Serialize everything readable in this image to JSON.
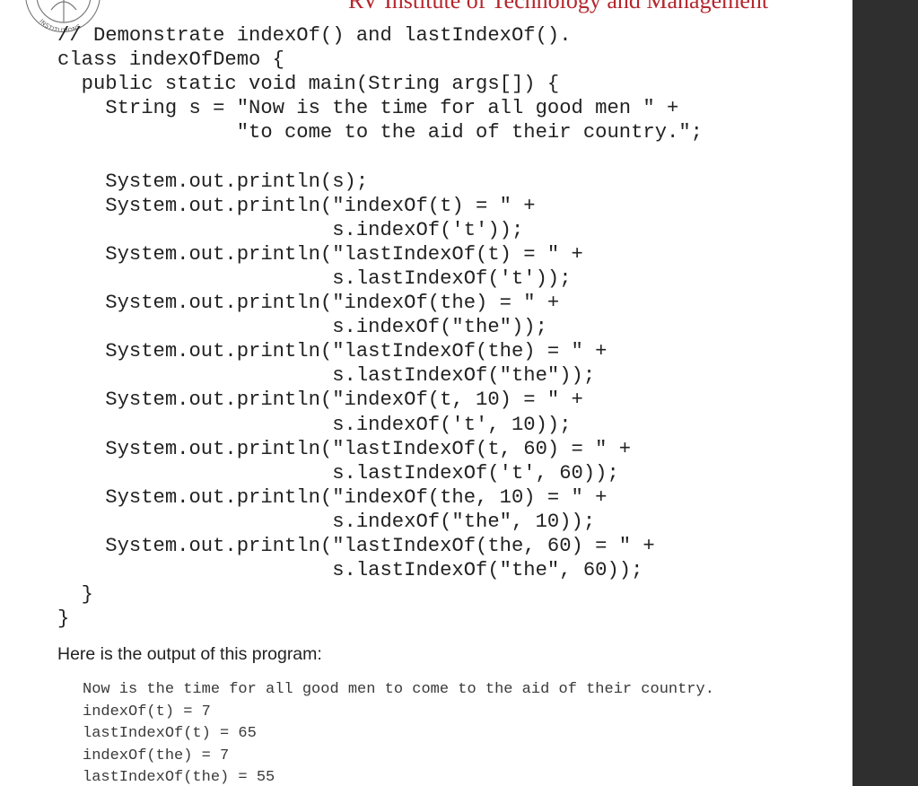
{
  "header": {
    "institute": "RV Institute of Technology and Management",
    "logo_text": "INSTITUTIONS"
  },
  "code_lines": [
    "// Demonstrate indexOf() and lastIndexOf().",
    "class indexOfDemo {",
    "  public static void main(String args[]) {",
    "    String s = \"Now is the time for all good men \" +",
    "               \"to come to the aid of their country.\";",
    "",
    "    System.out.println(s);",
    "    System.out.println(\"indexOf(t) = \" +",
    "                       s.indexOf('t'));",
    "    System.out.println(\"lastIndexOf(t) = \" +",
    "                       s.lastIndexOf('t'));",
    "    System.out.println(\"indexOf(the) = \" +",
    "                       s.indexOf(\"the\"));",
    "    System.out.println(\"lastIndexOf(the) = \" +",
    "                       s.lastIndexOf(\"the\"));",
    "    System.out.println(\"indexOf(t, 10) = \" +",
    "                       s.indexOf('t', 10));",
    "    System.out.println(\"lastIndexOf(t, 60) = \" +",
    "                       s.lastIndexOf('t', 60));",
    "    System.out.println(\"indexOf(the, 10) = \" +",
    "                       s.indexOf(\"the\", 10));",
    "    System.out.println(\"lastIndexOf(the, 60) = \" +",
    "                       s.lastIndexOf(\"the\", 60));",
    "  }",
    "}"
  ],
  "output_caption": "Here is the output of this program:",
  "output_lines": [
    "Now is the time for all good men to come to the aid of their country.",
    "indexOf(t) = 7",
    "lastIndexOf(t) = 65",
    "indexOf(the) = 7",
    "lastIndexOf(the) = 55"
  ],
  "colors": {
    "header_red": "#b4272d",
    "side_panel": "#2f2f2f",
    "code_text": "#222222"
  }
}
